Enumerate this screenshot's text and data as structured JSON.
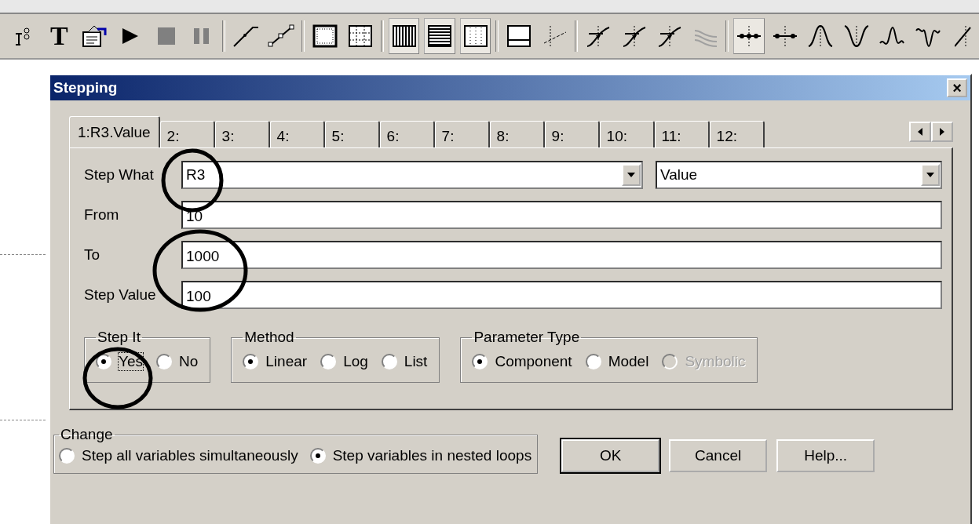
{
  "toolbar": [
    {
      "kind": "partial-ruler",
      "selected": false
    },
    {
      "kind": "text",
      "text": "T",
      "selected": false
    },
    {
      "kind": "properties",
      "selected": false
    },
    {
      "kind": "play",
      "selected": false
    },
    {
      "kind": "stop",
      "selected": false
    },
    {
      "kind": "pause",
      "selected": false
    },
    {
      "kind": "sep"
    },
    {
      "kind": "line",
      "selected": false
    },
    {
      "kind": "line-points",
      "selected": false
    },
    {
      "kind": "sep"
    },
    {
      "kind": "frame",
      "selected": false
    },
    {
      "kind": "grid",
      "selected": false
    },
    {
      "kind": "sep"
    },
    {
      "kind": "vlines",
      "selected": true
    },
    {
      "kind": "hlines",
      "selected": true
    },
    {
      "kind": "dots",
      "selected": true
    },
    {
      "kind": "sep"
    },
    {
      "kind": "split",
      "selected": false
    },
    {
      "kind": "dashslash",
      "selected": false
    },
    {
      "kind": "sep"
    },
    {
      "kind": "curve1",
      "selected": false
    },
    {
      "kind": "curve2",
      "selected": false
    },
    {
      "kind": "curve3",
      "selected": false
    },
    {
      "kind": "waves",
      "selected": false,
      "disabled": true
    },
    {
      "kind": "sep"
    },
    {
      "kind": "cross3",
      "selected": true
    },
    {
      "kind": "cross2",
      "selected": false
    },
    {
      "kind": "peak",
      "selected": false
    },
    {
      "kind": "valley",
      "selected": false
    },
    {
      "kind": "wave-up",
      "selected": false
    },
    {
      "kind": "wave-down",
      "selected": false
    },
    {
      "kind": "slash",
      "selected": false
    }
  ],
  "dialog": {
    "title": "Stepping",
    "close": "×",
    "tabs": [
      {
        "label": "1:R3.Value",
        "selected": true
      },
      {
        "label": "2:",
        "selected": false
      },
      {
        "label": "3:",
        "selected": false
      },
      {
        "label": "4:",
        "selected": false
      },
      {
        "label": "5:",
        "selected": false
      },
      {
        "label": "6:",
        "selected": false
      },
      {
        "label": "7:",
        "selected": false
      },
      {
        "label": "8:",
        "selected": false
      },
      {
        "label": "9:",
        "selected": false
      },
      {
        "label": "10:",
        "selected": false
      },
      {
        "label": "11:",
        "selected": false
      },
      {
        "label": "12:",
        "selected": false
      }
    ],
    "step_what": {
      "label": "Step What",
      "value": "R3",
      "property": "Value"
    },
    "fields": [
      {
        "label": "From",
        "value": "10"
      },
      {
        "label": "To",
        "value": "1000"
      },
      {
        "label": "Step Value",
        "value": "100"
      }
    ],
    "groups": [
      {
        "title": "Step It",
        "options": [
          {
            "label": "Yes",
            "selected": true,
            "focused": true,
            "disabled": false
          },
          {
            "label": "No",
            "selected": false,
            "focused": false,
            "disabled": false
          }
        ]
      },
      {
        "title": "Method",
        "options": [
          {
            "label": "Linear",
            "selected": true,
            "focused": false,
            "disabled": false
          },
          {
            "label": "Log",
            "selected": false,
            "focused": false,
            "disabled": false
          },
          {
            "label": "List",
            "selected": false,
            "focused": false,
            "disabled": false
          }
        ]
      },
      {
        "title": "Parameter Type",
        "options": [
          {
            "label": "Component",
            "selected": true,
            "focused": false,
            "disabled": false
          },
          {
            "label": "Model",
            "selected": false,
            "focused": false,
            "disabled": false
          },
          {
            "label": "Symbolic",
            "selected": false,
            "focused": false,
            "disabled": true
          }
        ]
      }
    ],
    "change": {
      "title": "Change",
      "options": [
        {
          "label": "Step all variables simultaneously",
          "selected": false
        },
        {
          "label": "Step variables in nested loops",
          "selected": true
        }
      ]
    },
    "buttons": [
      {
        "label": "OK",
        "default": true
      },
      {
        "label": "Cancel",
        "default": false
      },
      {
        "label": "Help...",
        "default": false
      }
    ]
  }
}
